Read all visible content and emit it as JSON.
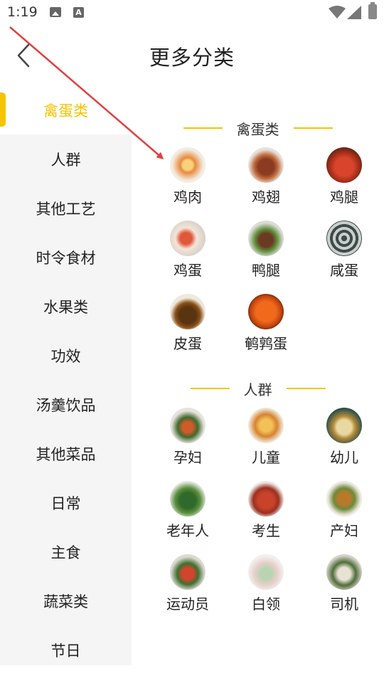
{
  "status_bar": {
    "time": "1:19",
    "icons": [
      "image-icon",
      "a-badge-icon",
      "wifi-icon",
      "signal-icon",
      "battery-icon"
    ]
  },
  "header": {
    "title": "更多分类",
    "back_icon": "chevron-left-icon"
  },
  "colors": {
    "accent": "#f5c400",
    "sidebar_bg": "#f5f5f5",
    "annotation": "#e04040"
  },
  "sidebar": {
    "active_index": 0,
    "items": [
      {
        "label": "禽蛋类"
      },
      {
        "label": "人群"
      },
      {
        "label": "其他工艺"
      },
      {
        "label": "时令食材"
      },
      {
        "label": "水果类"
      },
      {
        "label": "功效"
      },
      {
        "label": "汤羹饮品"
      },
      {
        "label": "其他菜品"
      },
      {
        "label": "日常"
      },
      {
        "label": "主食"
      },
      {
        "label": "蔬菜类"
      },
      {
        "label": "节日"
      }
    ]
  },
  "sections": [
    {
      "title": "禽蛋类",
      "items": [
        {
          "label": "鸡肉"
        },
        {
          "label": "鸡翅"
        },
        {
          "label": "鸡腿"
        },
        {
          "label": "鸡蛋"
        },
        {
          "label": "鸭腿"
        },
        {
          "label": "咸蛋"
        },
        {
          "label": "皮蛋"
        },
        {
          "label": "鹌鹑蛋"
        }
      ]
    },
    {
      "title": "人群",
      "items": [
        {
          "label": "孕妇"
        },
        {
          "label": "儿童"
        },
        {
          "label": "幼儿"
        },
        {
          "label": "老年人"
        },
        {
          "label": "考生"
        },
        {
          "label": "产妇"
        },
        {
          "label": "运动员"
        },
        {
          "label": "白领"
        },
        {
          "label": "司机"
        }
      ]
    }
  ]
}
